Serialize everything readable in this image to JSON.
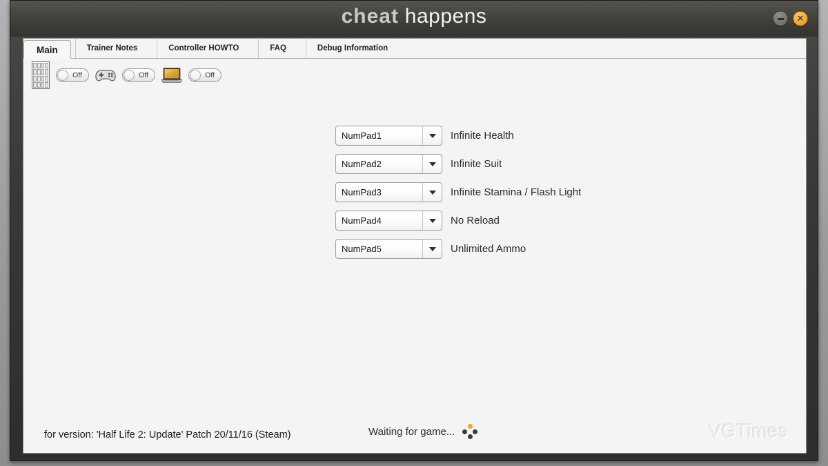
{
  "window": {
    "logo_bold": "cheat",
    "logo_light": "happens",
    "minimize_label": "–",
    "close_label": "✕"
  },
  "tabs": [
    {
      "label": "Main",
      "active": true
    },
    {
      "label": "Trainer Notes",
      "active": false
    },
    {
      "label": "Controller HOWTO",
      "active": false
    },
    {
      "label": "FAQ",
      "active": false
    },
    {
      "label": "Debug Information",
      "active": false
    }
  ],
  "toolbar": {
    "keypad_icon": "numeric-keypad-icon",
    "keypad_toggle": {
      "state": "Off"
    },
    "gamepad_icon": "gamepad-icon",
    "gamepad_toggle": {
      "state": "Off"
    },
    "laptop_icon": "laptop-icon",
    "laptop_toggle": {
      "state": "Off"
    }
  },
  "cheats": [
    {
      "hotkey": "NumPad1",
      "label": "Infinite Health"
    },
    {
      "hotkey": "NumPad2",
      "label": "Infinite Suit"
    },
    {
      "hotkey": "NumPad3",
      "label": "Infinite Stamina / Flash Light"
    },
    {
      "hotkey": "NumPad4",
      "label": "No Reload"
    },
    {
      "hotkey": "NumPad5",
      "label": "Unlimited Ammo"
    }
  ],
  "footer": {
    "version": "for version: 'Half Life 2: Update' Patch 20/11/16 (Steam)",
    "status": "Waiting for game...",
    "watermark": "VGTimes"
  },
  "colors": {
    "accent_orange": "#f0a828",
    "titlebar_dark": "#3b3a35",
    "client_bg": "#f4f4f4",
    "laptop_screen": "#d8a128"
  }
}
